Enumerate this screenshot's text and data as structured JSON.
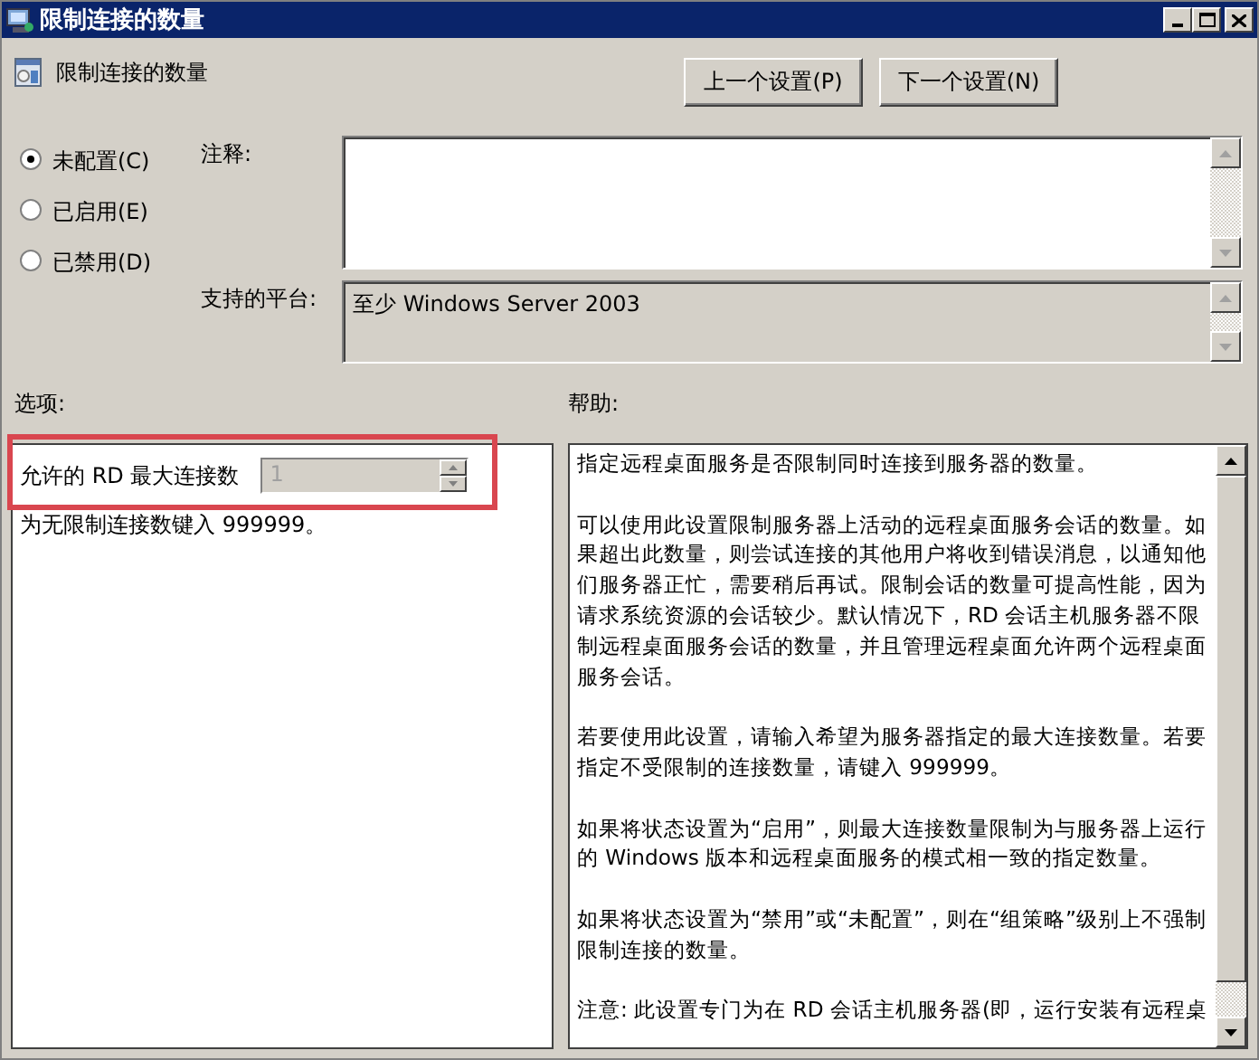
{
  "window": {
    "title": "限制连接的数量"
  },
  "header": {
    "title": "限制连接的数量"
  },
  "buttons": [
    {
      "label": "上一个设置(P)"
    },
    {
      "label": "下一个设置(N)"
    }
  ],
  "radios": [
    {
      "label": "未配置(C)",
      "selected": true
    },
    {
      "label": "已启用(E)",
      "selected": false
    },
    {
      "label": "已禁用(D)",
      "selected": false
    }
  ],
  "comment": {
    "label": "注释:"
  },
  "platform": {
    "label": "支持的平台:",
    "value": "至少 Windows Server 2003"
  },
  "options": {
    "label": "选项:",
    "setting": {
      "label": "允许的 RD 最大连接数",
      "value": "1",
      "disabled": true,
      "highlighted": true
    },
    "hint": "为无限制连接数键入 999999。"
  },
  "help": {
    "label": "帮助:",
    "paragraphs": [
      "指定远程桌面服务是否限制同时连接到服务器的数量。",
      "可以使用此设置限制服务器上活动的远程桌面服务会话的数量。如果超出此数量，则尝试连接的其他用户将收到错误消息，以通知他们服务器正忙，需要稍后再试。限制会话的数量可提高性能，因为请求系统资源的会话较少。默认情况下，RD 会话主机服务器不限制远程桌面服务会话的数量，并且管理远程桌面允许两个远程桌面服务会话。",
      "若要使用此设置，请输入希望为服务器指定的最大连接数量。若要指定不受限制的连接数量，请键入 999999。",
      "如果将状态设置为“启用”，则最大连接数量限制为与服务器上运行的 Windows 版本和远程桌面服务的模式相一致的指定数量。",
      "如果将状态设置为“禁用”或“未配置”，则在“组策略”级别上不强制限制连接的数量。",
      "注意: 此设置专门为在 RD 会话主机服务器(即，运行安装有远程桌"
    ]
  }
}
